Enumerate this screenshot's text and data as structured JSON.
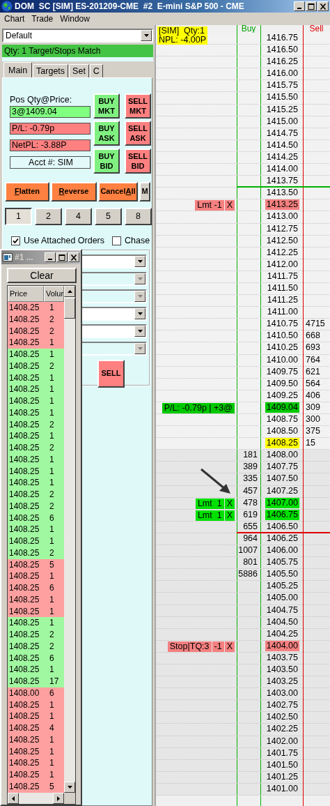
{
  "window": {
    "title": "DOM  SC [SIM] ES-201209-CME  #2  E-mini S&P 500 - CME"
  },
  "menu": [
    "Chart",
    "Trade",
    "Window"
  ],
  "profile": {
    "value": "Default"
  },
  "status": "Qty: 1 Target/Stops Match",
  "tabs": [
    {
      "label": "Main",
      "selected": true
    },
    {
      "label": "Targets",
      "selected": false
    },
    {
      "label": "Set",
      "selected": false
    },
    {
      "label": "C",
      "selected": false
    }
  ],
  "position": {
    "label": "Pos Qty@Price:",
    "fields": [
      {
        "text": "3@1409.04",
        "color": "#80ff80",
        "kind": "readout"
      },
      {
        "text": "P/L: -0.79p",
        "color": "#ff8080",
        "kind": "readout"
      },
      {
        "text": "NetPL: -3.88P",
        "color": "#ff8080",
        "kind": "readout"
      },
      {
        "text": "Acct #: SIM",
        "color": "#e4fafa",
        "kind": "account"
      }
    ]
  },
  "order_buttons": [
    {
      "label": "BUY MKT",
      "color": "#80f080"
    },
    {
      "label": "SELL MKT",
      "color": "#ff8080"
    },
    {
      "label": "BUY ASK",
      "color": "#80f080"
    },
    {
      "label": "SELL ASK",
      "color": "#ff8080"
    },
    {
      "label": "BUY BID",
      "color": "#80f080"
    },
    {
      "label": "SELL BID",
      "color": "#ff8080"
    }
  ],
  "actions": [
    {
      "key": "F",
      "rest": "latten",
      "accent": true
    },
    {
      "key": "R",
      "rest": "everse",
      "accent": true
    },
    {
      "text": "Cancel",
      "key": "A",
      "rest": "ll",
      "accent": true
    },
    {
      "text": "M",
      "accent": false
    }
  ],
  "quantities": [
    {
      "label": "1",
      "selected": true
    },
    {
      "label": "2",
      "selected": false
    },
    {
      "label": "4",
      "selected": false
    },
    {
      "label": "5",
      "selected": false
    },
    {
      "label": "8",
      "selected": false
    }
  ],
  "options": [
    {
      "label": "Use Attached Orders",
      "checked": true
    },
    {
      "label": "Chase",
      "checked": false
    }
  ],
  "dropdowns": [
    {
      "disabled": false
    },
    {
      "disabled": true
    },
    {
      "disabled": true
    },
    {
      "disabled": false
    },
    {
      "disabled": false
    },
    {
      "disabled": true
    }
  ],
  "sell_button": "SELL",
  "trades_window": {
    "title": "#1 ...",
    "clear": "Clear",
    "columns": [
      "Price",
      "Volur"
    ],
    "rows": [
      {
        "price": "1408.25",
        "volume": "1",
        "color": "#ffa0a0"
      },
      {
        "price": "1408.25",
        "volume": "2",
        "color": "#ffa0a0"
      },
      {
        "price": "1408.25",
        "volume": "2",
        "color": "#ffa0a0"
      },
      {
        "price": "1408.25",
        "volume": "1",
        "color": "#ffa0a0"
      },
      {
        "price": "1408.25",
        "volume": "1",
        "color": "#a0f8a0"
      },
      {
        "price": "1408.25",
        "volume": "2",
        "color": "#a0f8a0"
      },
      {
        "price": "1408.25",
        "volume": "1",
        "color": "#a0f8a0"
      },
      {
        "price": "1408.25",
        "volume": "1",
        "color": "#a0f8a0"
      },
      {
        "price": "1408.25",
        "volume": "1",
        "color": "#a0f8a0"
      },
      {
        "price": "1408.25",
        "volume": "1",
        "color": "#a0f8a0"
      },
      {
        "price": "1408.25",
        "volume": "2",
        "color": "#a0f8a0"
      },
      {
        "price": "1408.25",
        "volume": "1",
        "color": "#a0f8a0"
      },
      {
        "price": "1408.25",
        "volume": "2",
        "color": "#a0f8a0"
      },
      {
        "price": "1408.25",
        "volume": "1",
        "color": "#a0f8a0"
      },
      {
        "price": "1408.25",
        "volume": "1",
        "color": "#a0f8a0"
      },
      {
        "price": "1408.25",
        "volume": "1",
        "color": "#a0f8a0"
      },
      {
        "price": "1408.25",
        "volume": "2",
        "color": "#a0f8a0"
      },
      {
        "price": "1408.25",
        "volume": "2",
        "color": "#a0f8a0"
      },
      {
        "price": "1408.25",
        "volume": "6",
        "color": "#a0f8a0"
      },
      {
        "price": "1408.25",
        "volume": "1",
        "color": "#a0f8a0"
      },
      {
        "price": "1408.25",
        "volume": "1",
        "color": "#a0f8a0"
      },
      {
        "price": "1408.25",
        "volume": "2",
        "color": "#a0f8a0"
      },
      {
        "price": "1408.25",
        "volume": "5",
        "color": "#ffa0a0"
      },
      {
        "price": "1408.25",
        "volume": "1",
        "color": "#ffa0a0"
      },
      {
        "price": "1408.25",
        "volume": "6",
        "color": "#ffa0a0"
      },
      {
        "price": "1408.25",
        "volume": "1",
        "color": "#ffa0a0"
      },
      {
        "price": "1408.25",
        "volume": "1",
        "color": "#ffa0a0"
      },
      {
        "price": "1408.25",
        "volume": "1",
        "color": "#a0f8a0"
      },
      {
        "price": "1408.25",
        "volume": "2",
        "color": "#a0f8a0"
      },
      {
        "price": "1408.25",
        "volume": "2",
        "color": "#a0f8a0"
      },
      {
        "price": "1408.25",
        "volume": "6",
        "color": "#a0f8a0"
      },
      {
        "price": "1408.25",
        "volume": "1",
        "color": "#a0f8a0"
      },
      {
        "price": "1408.25",
        "volume": "17",
        "color": "#a0f8a0"
      },
      {
        "price": "1408.00",
        "volume": "6",
        "color": "#ffa0a0"
      },
      {
        "price": "1408.25",
        "volume": "1",
        "color": "#ffa0a0"
      },
      {
        "price": "1408.25",
        "volume": "1",
        "color": "#ffa0a0"
      },
      {
        "price": "1408.25",
        "volume": "4",
        "color": "#ffa0a0"
      },
      {
        "price": "1408.25",
        "volume": "1",
        "color": "#ffa0a0"
      },
      {
        "price": "1408.25",
        "volume": "1",
        "color": "#ffa0a0"
      },
      {
        "price": "1408.25",
        "volume": "1",
        "color": "#ffa0a0"
      },
      {
        "price": "1408.25",
        "volume": "1",
        "color": "#ffa0a0"
      },
      {
        "price": "1408.25",
        "volume": "5",
        "color": "#ffa0a0"
      }
    ]
  },
  "ladder": {
    "account": "[SIM]  Qty:1",
    "npl": "NPL: -4.00P",
    "buy_header": "Buy",
    "sell_header": "Sell",
    "rows": [
      {
        "price": "1416.75",
        "shaded": false
      },
      {
        "price": "1416.50",
        "shaded": false
      },
      {
        "price": "1416.25",
        "shaded": false
      },
      {
        "price": "1416.00",
        "shaded": false
      },
      {
        "price": "1415.75",
        "shaded": false
      },
      {
        "price": "1415.50",
        "shaded": false
      },
      {
        "price": "1415.25",
        "shaded": false
      },
      {
        "price": "1415.00",
        "shaded": false
      },
      {
        "price": "1414.75",
        "shaded": false
      },
      {
        "price": "1414.50",
        "shaded": false
      },
      {
        "price": "1414.25",
        "shaded": false
      },
      {
        "price": "1414.00",
        "shaded": false
      },
      {
        "price": "1413.75",
        "shaded": false,
        "rule": {
          "color": "#00b000"
        }
      },
      {
        "price": "1413.50",
        "shaded": false
      },
      {
        "price": "1413.25",
        "shaded": false,
        "highlight": {
          "color": "#f58080"
        },
        "order": {
          "parts": [
            "Lmt -1",
            "X"
          ],
          "color": "#f58080"
        }
      },
      {
        "price": "1413.00",
        "shaded": false
      },
      {
        "price": "1412.75",
        "shaded": false
      },
      {
        "price": "1412.50",
        "shaded": false
      },
      {
        "price": "1412.25",
        "shaded": false
      },
      {
        "price": "1412.00",
        "shaded": false
      },
      {
        "price": "1411.75",
        "shaded": false
      },
      {
        "price": "1411.50",
        "shaded": false
      },
      {
        "price": "1411.25",
        "shaded": false
      },
      {
        "price": "1411.00",
        "shaded": false
      },
      {
        "price": "1410.75",
        "shaded": false,
        "sell": "4715"
      },
      {
        "price": "1410.50",
        "shaded": false,
        "sell": "668"
      },
      {
        "price": "1410.25",
        "shaded": false,
        "sell": "693"
      },
      {
        "price": "1410.00",
        "shaded": false,
        "sell": "764"
      },
      {
        "price": "1409.75",
        "shaded": false,
        "sell": "621"
      },
      {
        "price": "1409.50",
        "shaded": false,
        "sell": "564"
      },
      {
        "price": "1409.25",
        "shaded": false,
        "sell": "406"
      },
      {
        "price": "1409.04",
        "shaded": false,
        "sell": "309",
        "highlight": {
          "color": "#00c800"
        },
        "order": {
          "parts": [
            "P/L: -0.79p | +3@"
          ],
          "color": "#00c800"
        }
      },
      {
        "price": "1408.75",
        "shaded": false,
        "sell": "300"
      },
      {
        "price": "1408.50",
        "shaded": false,
        "sell": "375"
      },
      {
        "price": "1408.25",
        "shaded": false,
        "sell": "15",
        "highlight": {
          "color": "#ffff00"
        }
      },
      {
        "price": "1408.00",
        "shaded": true,
        "buy": "181"
      },
      {
        "price": "1407.75",
        "shaded": true,
        "buy": "389"
      },
      {
        "price": "1407.50",
        "shaded": true,
        "buy": "335"
      },
      {
        "price": "1407.25",
        "shaded": true,
        "buy": "457"
      },
      {
        "price": "1407.00",
        "shaded": true,
        "buy": "478",
        "highlight": {
          "color": "#00e000"
        },
        "order": {
          "parts": [
            "Lmt  1",
            "X"
          ],
          "color": "#00e000"
        }
      },
      {
        "price": "1406.75",
        "shaded": true,
        "buy": "619",
        "highlight": {
          "color": "#00e000"
        },
        "order": {
          "parts": [
            "Lmt  1",
            "X"
          ],
          "color": "#00e000"
        }
      },
      {
        "price": "1406.50",
        "shaded": true,
        "buy": "655",
        "rule": {
          "color": "#e00000"
        }
      },
      {
        "price": "1406.25",
        "shaded": true,
        "buy": "964"
      },
      {
        "price": "1406.00",
        "shaded": true,
        "buy": "1007"
      },
      {
        "price": "1405.75",
        "shaded": true,
        "buy": "801"
      },
      {
        "price": "1405.50",
        "shaded": true,
        "buy": "5886"
      },
      {
        "price": "1405.25",
        "shaded": true
      },
      {
        "price": "1405.00",
        "shaded": true
      },
      {
        "price": "1404.75",
        "shaded": true
      },
      {
        "price": "1404.50",
        "shaded": true
      },
      {
        "price": "1404.25",
        "shaded": true
      },
      {
        "price": "1404.00",
        "shaded": true,
        "highlight": {
          "color": "#f58080"
        },
        "order": {
          "parts": [
            "Stop|TQ:3",
            "-1",
            "X"
          ],
          "color": "#f58080"
        }
      },
      {
        "price": "1403.75",
        "shaded": true
      },
      {
        "price": "1403.50",
        "shaded": true
      },
      {
        "price": "1403.25",
        "shaded": true
      },
      {
        "price": "1403.00",
        "shaded": true
      },
      {
        "price": "1402.75",
        "shaded": true
      },
      {
        "price": "1402.50",
        "shaded": true
      },
      {
        "price": "1402.25",
        "shaded": true
      },
      {
        "price": "1402.00",
        "shaded": true
      },
      {
        "price": "1401.75",
        "shaded": true
      },
      {
        "price": "1401.50",
        "shaded": true
      },
      {
        "price": "1401.25",
        "shaded": true
      },
      {
        "price": "1401.00",
        "shaded": true
      }
    ]
  }
}
